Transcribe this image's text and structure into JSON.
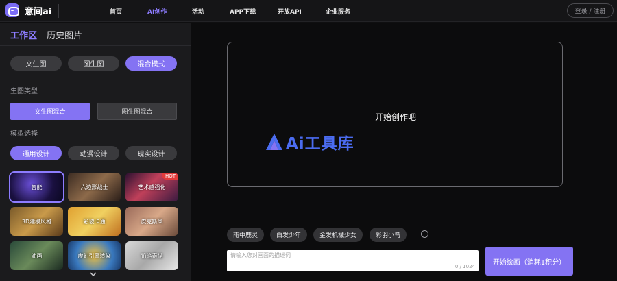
{
  "app": {
    "name": "意间ai"
  },
  "nav": {
    "items": [
      "首页",
      "AI创作",
      "活动",
      "APP下载",
      "开放API",
      "企业服务"
    ],
    "active_index": 1,
    "login_label": "登录 / 注册"
  },
  "sidebar": {
    "tabs": [
      "工作区",
      "历史图片"
    ],
    "modes": [
      "文生图",
      "图生图",
      "混合模式"
    ],
    "active_mode_index": 2,
    "gen_type_label": "生图类型",
    "gen_types": [
      "文生图混合",
      "图生图混合"
    ],
    "active_gen_type_index": 0,
    "model_label": "模型选择",
    "model_tabs": [
      "通用设计",
      "动漫设计",
      "现实设计"
    ],
    "active_model_tab_index": 0,
    "models": [
      {
        "label": "智能",
        "selected": true
      },
      {
        "label": "六边形战士"
      },
      {
        "label": "艺术感强化",
        "badge": "HOT"
      },
      {
        "label": "3D建模风格"
      },
      {
        "label": "彩玻卡通"
      },
      {
        "label": "皮克斯风"
      },
      {
        "label": "油画"
      },
      {
        "label": "虚幻引擎渲染"
      },
      {
        "label": "铅笔素描"
      }
    ]
  },
  "canvas": {
    "prompt_text": "开始创作吧",
    "watermark": "Ai工具库"
  },
  "chips": [
    "雨中鹿灵",
    "白发少年",
    "金发机械少女",
    "彩羽小鸟"
  ],
  "prompt": {
    "placeholder": "请输入您对画面的描述词",
    "counter": "0 / 1024"
  },
  "generate": {
    "label": "开始绘画（消耗1积分）"
  },
  "colors": {
    "accent": "#8473f3",
    "watermark": "#4b6cf0",
    "hot": "#e33b3b"
  }
}
